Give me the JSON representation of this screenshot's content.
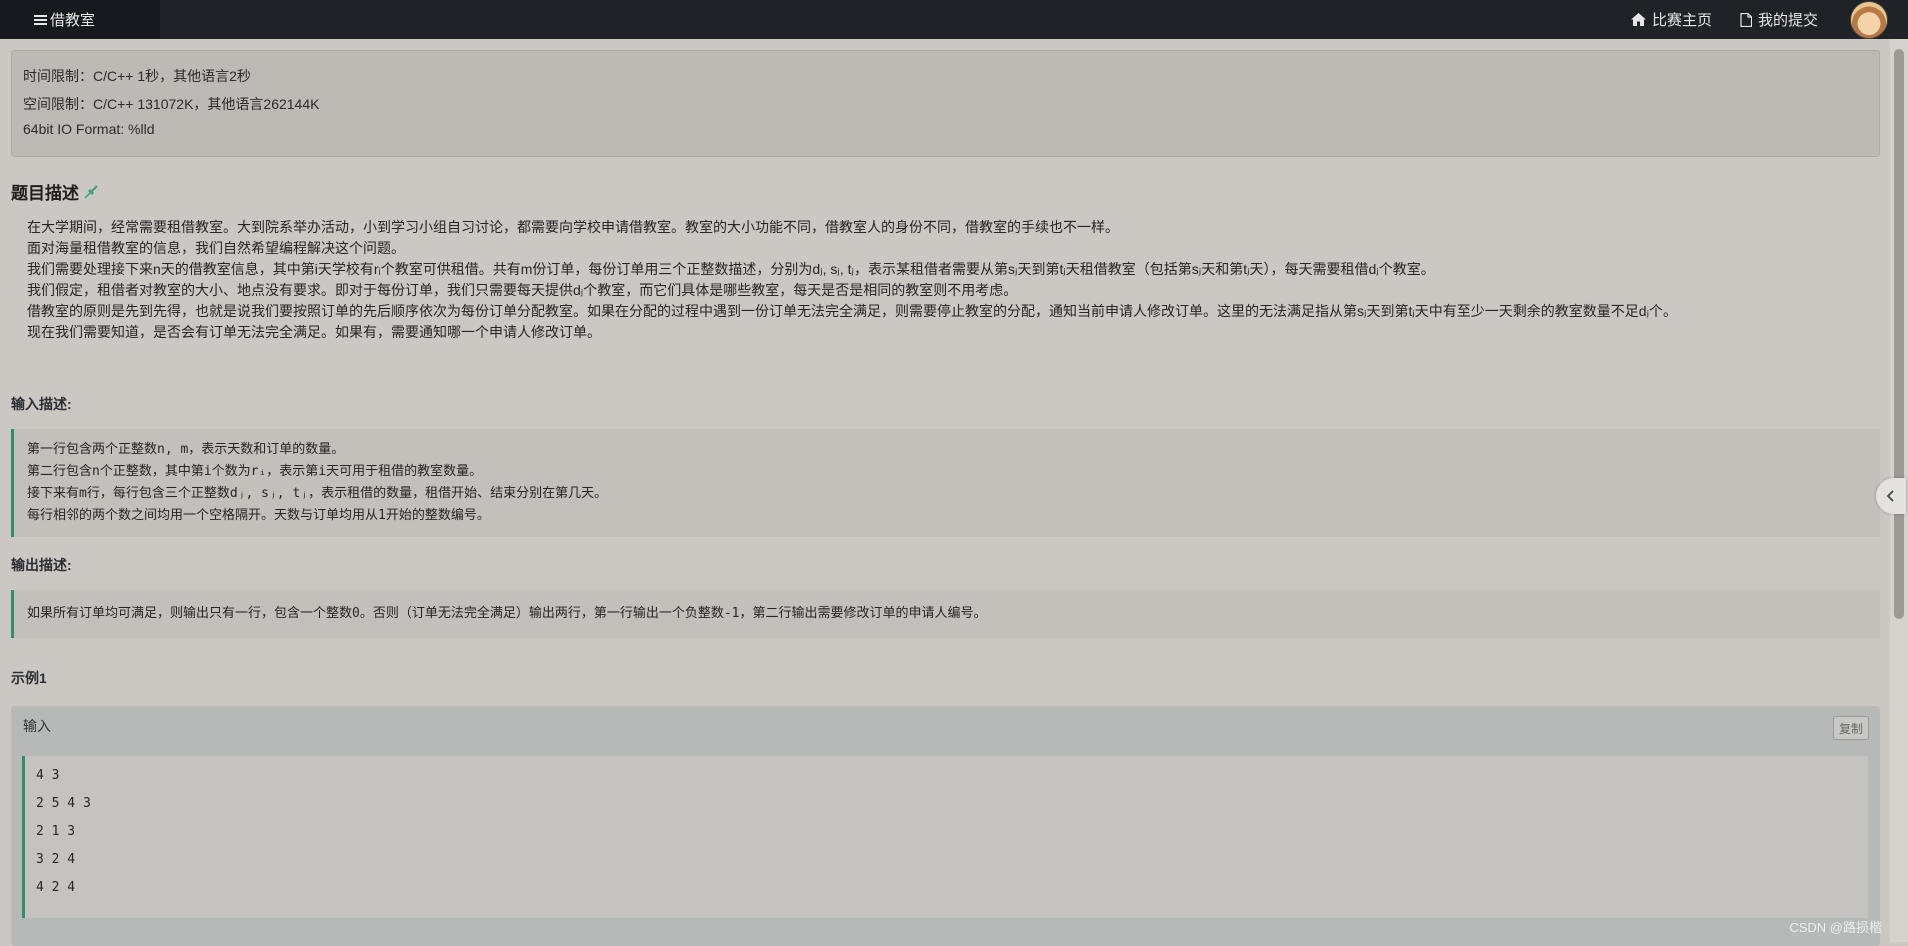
{
  "navbar": {
    "brand": "借教室",
    "links": [
      "比赛主页",
      "我的提交"
    ]
  },
  "limits": {
    "time": "时间限制：C/C++ 1秒，其他语言2秒",
    "space": "空间限制：C/C++ 131072K，其他语言262144K",
    "io": "64bit IO Format: %lld"
  },
  "problem": {
    "title": "题目描述",
    "paragraphs": [
      "在大学期间，经常需要租借教室。大到院系举办活动，小到学习小组自习讨论，都需要向学校申请借教室。教室的大小功能不同，借教室人的身份不同，借教室的手续也不一样。",
      "面对海量租借教室的信息，我们自然希望编程解决这个问题。",
      "我们需要处理接下来n天的借教室信息，其中第i天学校有rᵢ个教室可供租借。共有m份订单，每份订单用三个正整数描述，分别为dⱼ, sⱼ, tⱼ，表示某租借者需要从第sⱼ天到第tⱼ天租借教室（包括第sⱼ天和第tⱼ天），每天需要租借dⱼ个教室。",
      "我们假定，租借者对教室的大小、地点没有要求。即对于每份订单，我们只需要每天提供dⱼ个教室，而它们具体是哪些教室，每天是否是相同的教室则不用考虑。",
      "借教室的原则是先到先得，也就是说我们要按照订单的先后顺序依次为每份订单分配教室。如果在分配的过程中遇到一份订单无法完全满足，则需要停止教室的分配，通知当前申请人修改订单。这里的无法满足指从第sⱼ天到第tⱼ天中有至少一天剩余的教室数量不足dⱼ个。",
      "现在我们需要知道，是否会有订单无法完全满足。如果有，需要通知哪一个申请人修改订单。"
    ]
  },
  "input_desc": {
    "title": "输入描述:",
    "lines": [
      "第一行包含两个正整数n, m，表示天数和订单的数量。",
      "第二行包含n个正整数，其中第i个数为rᵢ，表示第i天可用于租借的教室数量。",
      "接下来有m行，每行包含三个正整数dⱼ, sⱼ, tⱼ，表示租借的数量，租借开始、结束分别在第几天。",
      "每行相邻的两个数之间均用一个空格隔开。天数与订单均用从1开始的整数编号。"
    ]
  },
  "output_desc": {
    "title": "输出描述:",
    "lines": [
      "如果所有订单均可满足，则输出只有一行，包含一个整数0。否则（订单无法完全满足）输出两行，第一行输出一个负整数-1，第二行输出需要修改订单的申请人编号。"
    ]
  },
  "example": {
    "title": "示例1",
    "input_label": "输入",
    "copy_label": "复制",
    "input_lines": [
      "4 3",
      "2 5 4 3",
      "2 1 3",
      "3 2 4",
      "4 2 4"
    ]
  },
  "watermark": "CSDN @路损楷",
  "icons": {
    "brand": "list-icon",
    "home": "home-icon",
    "submission": "file-icon",
    "pin": "pin-icon",
    "toggle": "chevron-left-icon"
  },
  "colors": {
    "navbar": "#1f2328",
    "accent": "#2f8f6b"
  }
}
